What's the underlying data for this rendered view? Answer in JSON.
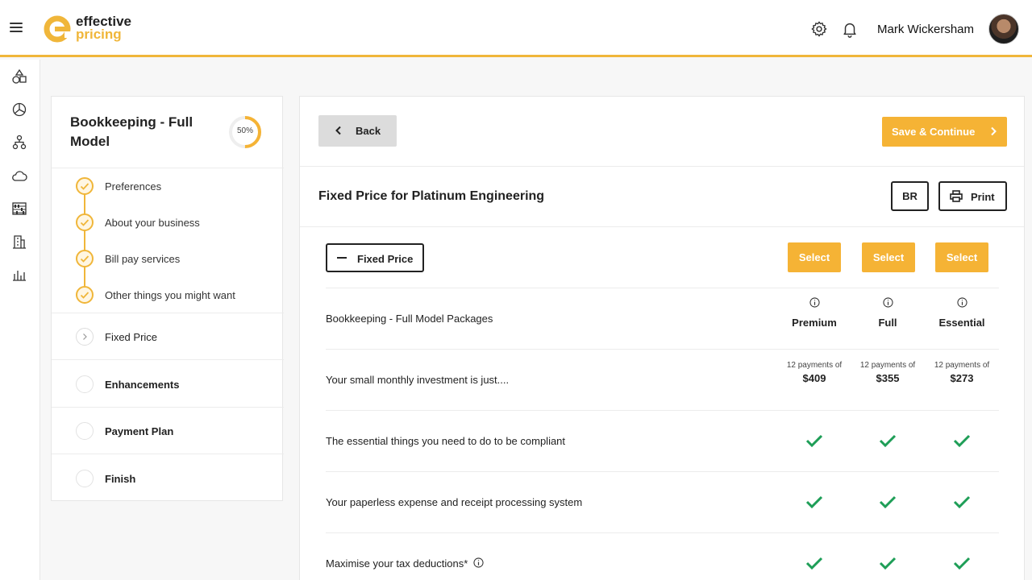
{
  "header": {
    "logo_line1": "effective",
    "logo_line2": "pricing",
    "user_name": "Mark Wickersham",
    "icons": [
      "menu-icon",
      "gear-icon",
      "bell-icon",
      "avatar"
    ]
  },
  "rail": {
    "icons": [
      "shapes-icon",
      "pie-chart-icon",
      "org-chart-icon",
      "cloud-icon",
      "abacus-icon",
      "building-icon",
      "bar-chart-icon"
    ]
  },
  "steps": {
    "title": "Bookkeeping - Full Model",
    "progress_label": "50%",
    "progress_fraction": 0.5,
    "completed": [
      "Preferences",
      "About your business",
      "Bill pay services",
      "Other things you might want"
    ],
    "sections": [
      {
        "label": "Fixed Price",
        "state": "current"
      },
      {
        "label": "Enhancements",
        "state": "pending"
      },
      {
        "label": "Payment Plan",
        "state": "pending"
      },
      {
        "label": "Finish",
        "state": "pending"
      }
    ]
  },
  "main": {
    "back_label": "Back",
    "save_label": "Save & Continue",
    "title": "Fixed Price for Platinum Engineering",
    "br_label": "BR",
    "print_label": "Print",
    "fixed_price_label": "Fixed Price",
    "select_label": "Select",
    "packages_label": "Bookkeeping - Full Model Packages",
    "columns": [
      "Premium",
      "Full",
      "Essential"
    ],
    "investment_label": "Your small monthly investment is just....",
    "payments_prefix": "12 payments of",
    "prices": [
      "$409",
      "$355",
      "$273"
    ],
    "features": [
      "The essential things you need to do to be compliant",
      "Your paperless expense and receipt processing system",
      "Maximise your tax deductions*"
    ]
  },
  "colors": {
    "accent": "#f5b335",
    "check": "#1e9e57",
    "text": "#222222"
  }
}
